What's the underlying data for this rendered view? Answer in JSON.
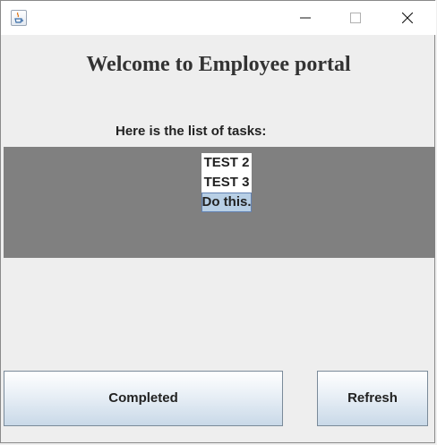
{
  "window": {
    "title": "",
    "icon": "java-cup-icon"
  },
  "main": {
    "heading": "Welcome to Employee portal",
    "list_caption": "Here is the list of tasks:",
    "tasks": [
      {
        "label": "TEST 2",
        "selected": false
      },
      {
        "label": "TEST 3",
        "selected": false
      },
      {
        "label": "Do this.",
        "selected": true
      }
    ]
  },
  "buttons": {
    "completed": "Completed",
    "refresh": "Refresh"
  },
  "colors": {
    "list_panel_bg": "#808080",
    "selection_bg": "#b8cfe5",
    "window_bg": "#eeeeee"
  }
}
